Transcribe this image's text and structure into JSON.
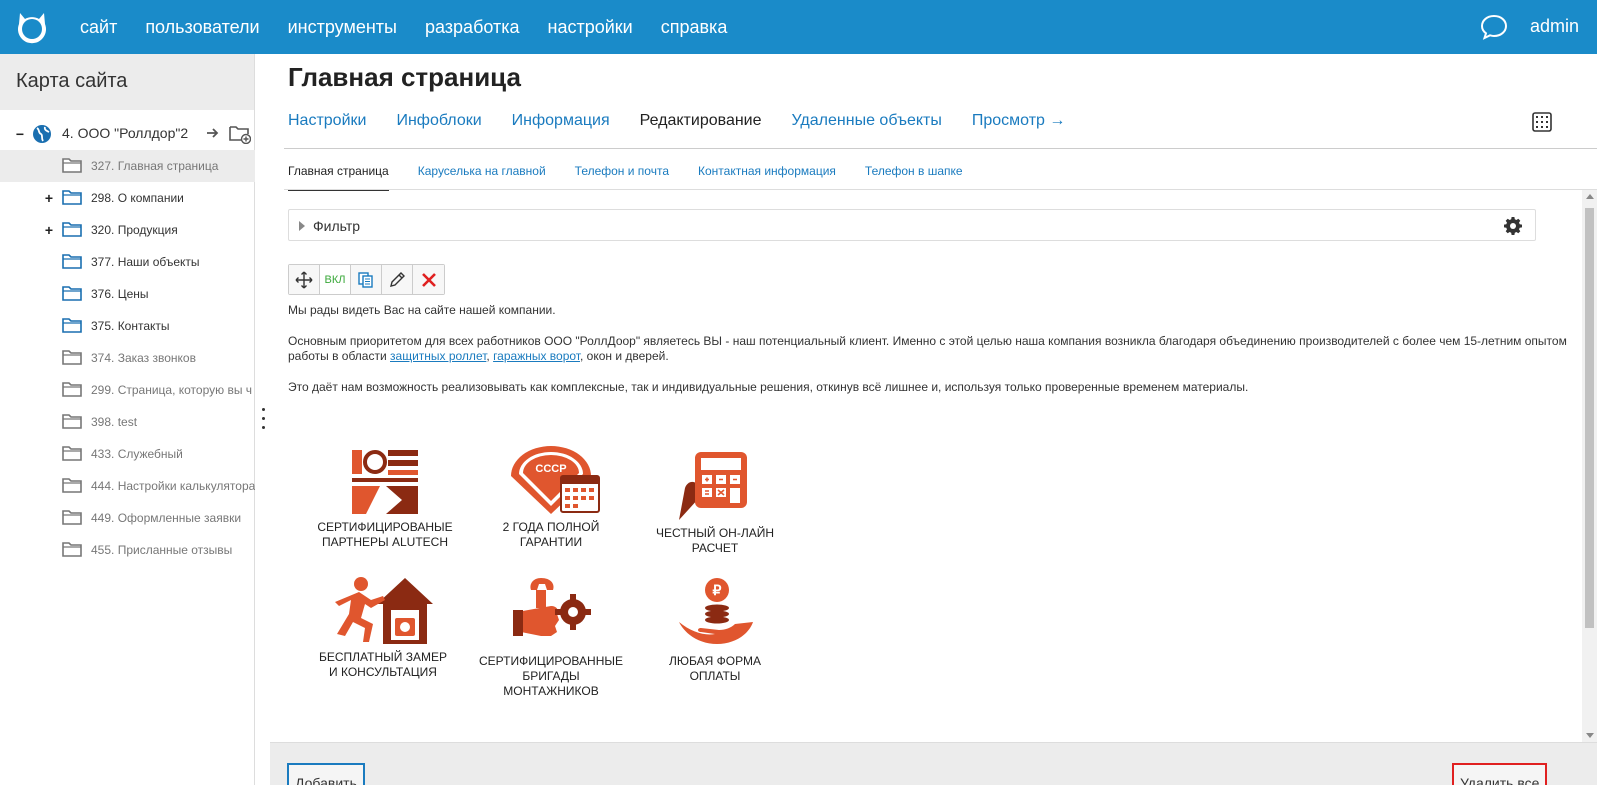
{
  "topbar": {
    "nav": [
      "сайт",
      "пользователи",
      "инструменты",
      "разработка",
      "настройки",
      "справка"
    ],
    "user": "admin",
    "accent_color": "#1a8bc9"
  },
  "sidebar": {
    "title": "Карта сайта",
    "tree": [
      {
        "toggle": "−",
        "icon": "globe-icon",
        "label": "4. ООО \"Роллдор\"2",
        "root": true
      },
      {
        "toggle": "",
        "icon": "folder-icon",
        "label": "327. Главная страница",
        "active": true,
        "disabled": true
      },
      {
        "toggle": "+",
        "icon": "folder-icon",
        "label": "298. О компании"
      },
      {
        "toggle": "+",
        "icon": "folder-icon",
        "label": "320. Продукция"
      },
      {
        "toggle": "",
        "icon": "folder-icon",
        "label": "377. Наши объекты"
      },
      {
        "toggle": "",
        "icon": "folder-icon",
        "label": "376. Цены"
      },
      {
        "toggle": "",
        "icon": "folder-icon",
        "label": "375. Контакты"
      },
      {
        "toggle": "",
        "icon": "folder-icon",
        "label": "374. Заказ звонков",
        "disabled": true
      },
      {
        "toggle": "",
        "icon": "folder-icon",
        "label": "299. Страница, которую вы ч",
        "disabled": true
      },
      {
        "toggle": "",
        "icon": "folder-icon",
        "label": "398. test",
        "disabled": true
      },
      {
        "toggle": "",
        "icon": "folder-icon",
        "label": "433. Служебный",
        "disabled": true
      },
      {
        "toggle": "",
        "icon": "folder-icon",
        "label": "444. Настройки калькулятора",
        "disabled": true
      },
      {
        "toggle": "",
        "icon": "folder-icon",
        "label": "449. Оформленные заявки",
        "disabled": true
      },
      {
        "toggle": "",
        "icon": "folder-icon",
        "label": "455. Присланные отзывы",
        "disabled": true
      }
    ]
  },
  "main": {
    "title": "Главная страница",
    "tabs": [
      "Настройки",
      "Инфоблоки",
      "Информация",
      "Редактирование",
      "Удаленные объекты",
      "Просмотр →"
    ],
    "active_tab": 3,
    "subtabs": [
      "Главная страница",
      "Каруселька на главной",
      "Телефон и почта",
      "Контактная информация",
      "Телефон в шапке"
    ],
    "active_subtab": 0,
    "filter_label": "Фильтр",
    "toolbar": {
      "toggle_label": "ВКЛ"
    },
    "text": {
      "p1": "Мы рады видеть Вас на сайте нашей компании.",
      "p2_before": "Основным приоритетом для всех работников ООО \"РоллДоор\" являетесь ВЫ - наш потенциальный клиент. Именно с этой целью наша компания возникла благодаря объединению производителей с более чем 15-летним опытом работы в области ",
      "p2_link1": "защитных роллет",
      "p2_sep": ", ",
      "p2_link2": "гаражных ворот",
      "p2_after": ", окон и дверей.",
      "p3": "Это даёт нам возможность реализовывать как комплексные, так и индивидуальные решения, откинув всё лишнее и, используя только проверенные временем материалы."
    },
    "features": [
      {
        "icon": "alutech-logo-icon",
        "line1": "СЕРТИФИЦИРОВАНЫЕ",
        "line2": "ПАРТНЕРЫ ALUTECH"
      },
      {
        "icon": "ussr-quality-badge-icon",
        "line1": "2 ГОДА ПОЛНОЙ",
        "line2": "ГАРАНТИИ"
      },
      {
        "icon": "calculator-hand-icon",
        "line1": "ЧЕСТНЫЙ ОН-ЛАЙН",
        "line2": "РАСЧЕТ"
      },
      {
        "icon": "runner-house-icon",
        "line1": "БЕСПЛАТНЫЙ ЗАМЕР",
        "line2": "И КОНСУЛЬТАЦИЯ"
      },
      {
        "icon": "wrench-hand-gear-icon",
        "line1": "СЕРТИФИЦИРОВАННЫЕ",
        "line2": "БРИГАДЫ МОНТАЖНИКОВ"
      },
      {
        "icon": "coins-hand-icon",
        "line1": "ЛЮБАЯ ФОРМА",
        "line2": "ОПЛАТЫ"
      }
    ],
    "feature_color": "#e0562e"
  },
  "footer": {
    "add_label": "Добавить",
    "delete_all_label": "Удалить все"
  }
}
